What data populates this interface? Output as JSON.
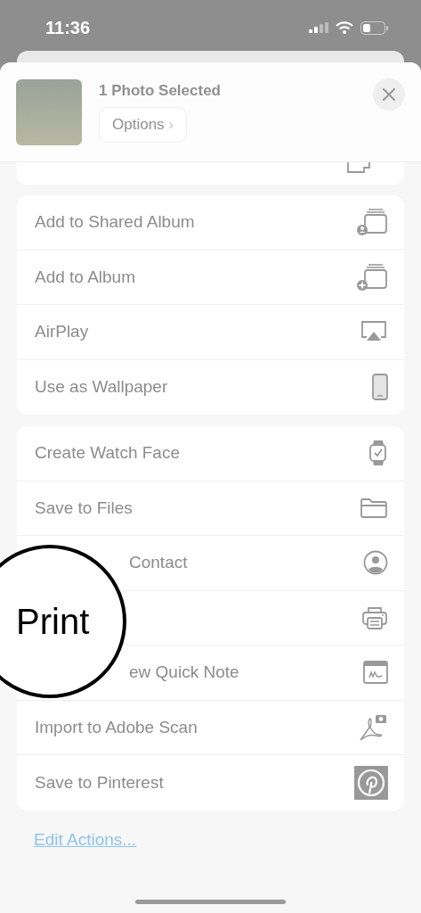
{
  "status_bar": {
    "time": "11:36"
  },
  "header": {
    "title": "1 Photo Selected",
    "options_button": "Options",
    "options_chevron": "›"
  },
  "groups": [
    {
      "items": [
        {
          "kind": "full",
          "label": "Add to Shared Album"
        },
        {
          "kind": "full",
          "label": "Add to Album"
        },
        {
          "kind": "full",
          "label": "AirPlay"
        },
        {
          "kind": "full",
          "label": "Use as Wallpaper"
        }
      ]
    },
    {
      "items": [
        {
          "kind": "full",
          "label": "Create Watch Face"
        },
        {
          "kind": "full",
          "label": "Save to Files"
        },
        {
          "kind": "partial",
          "label": "Contact"
        },
        {
          "kind": "covered"
        },
        {
          "kind": "partial",
          "label": "ew Quick Note"
        },
        {
          "kind": "full",
          "label": "Import to Adobe Scan"
        },
        {
          "kind": "full",
          "label": "Save to Pinterest"
        }
      ]
    }
  ],
  "edit_actions": "Edit Actions...",
  "magnifier": {
    "text": "Print"
  }
}
